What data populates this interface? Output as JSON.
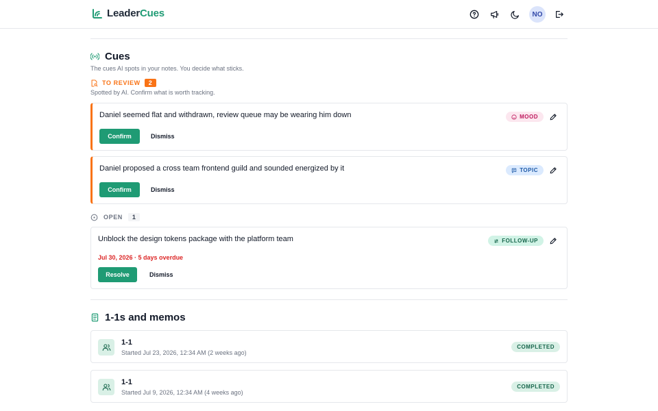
{
  "app": {
    "name_part1": "Leader",
    "name_part2": "Cues",
    "brand_color": "#1f9b74",
    "user_initials": "NO"
  },
  "header_icons": [
    "help-icon",
    "megaphone-icon",
    "moon-icon",
    "logout-icon"
  ],
  "cues": {
    "title": "Cues",
    "subtitle": "The cues AI spots in your notes. You decide what sticks.",
    "review": {
      "label": "TO REVIEW",
      "count": "2",
      "hint": "Spotted by AI. Confirm what is worth tracking.",
      "accent": "#f97316",
      "items": [
        {
          "text": "Daniel seemed flat and withdrawn, review queue may be wearing him down",
          "tag": "MOOD",
          "tag_icon": "smile-icon",
          "confirm": "Confirm",
          "dismiss": "Dismiss"
        },
        {
          "text": "Daniel proposed a cross team frontend guild and sounded energized by it",
          "tag": "TOPIC",
          "tag_icon": "message-icon",
          "confirm": "Confirm",
          "dismiss": "Dismiss"
        }
      ]
    },
    "open": {
      "label": "OPEN",
      "count": "1",
      "items": [
        {
          "text": "Unblock the design tokens package with the platform team",
          "tag": "FOLLOW-UP",
          "tag_icon": "follow-up-icon",
          "due": "Jul 30, 2026 · 5 days overdue",
          "resolve": "Resolve",
          "dismiss": "Dismiss"
        }
      ]
    }
  },
  "sessions": {
    "title": "1-1s and memos",
    "items": [
      {
        "title": "1-1",
        "meta": "Started Jul 23, 2026, 12:34 AM (2 weeks ago)",
        "status": "COMPLETED"
      },
      {
        "title": "1-1",
        "meta": "Started Jul 9, 2026, 12:34 AM (4 weeks ago)",
        "status": "COMPLETED"
      }
    ]
  }
}
